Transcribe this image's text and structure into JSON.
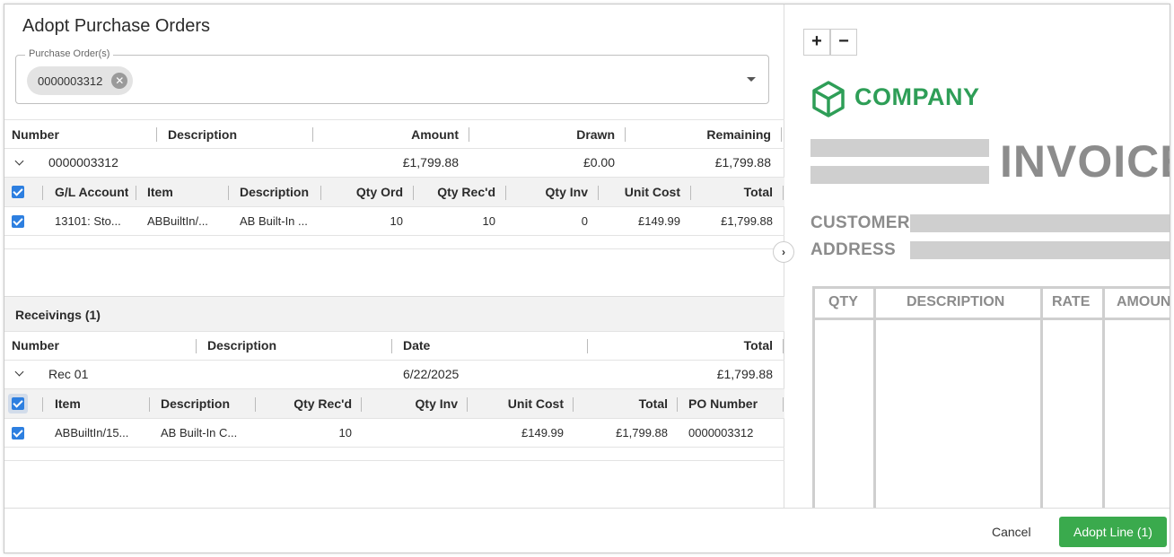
{
  "dialog": {
    "title": "Adopt Purchase Orders",
    "po_field_label": "Purchase Order(s)",
    "po_chip": "0000003312"
  },
  "po_table": {
    "headers": [
      "Number",
      "Description",
      "Amount",
      "Drawn",
      "Remaining"
    ],
    "row": {
      "number": "0000003312",
      "description": "",
      "amount": "£1,799.88",
      "drawn": "£0.00",
      "remaining": "£1,799.88"
    },
    "line_headers": [
      "G/L Account",
      "Item",
      "Description",
      "Qty Ord",
      "Qty Rec'd",
      "Qty Inv",
      "Unit Cost",
      "Total"
    ],
    "line": {
      "gl_account": "13101: Sto...",
      "item": "ABBuiltIn/...",
      "description": "AB Built-In ...",
      "qty_ord": "10",
      "qty_recd": "10",
      "qty_inv": "0",
      "unit_cost": "£149.99",
      "total": "£1,799.88"
    }
  },
  "receivings": {
    "title": "Receivings (1)",
    "headers": [
      "Number",
      "Description",
      "Date",
      "Total"
    ],
    "row": {
      "number": "Rec 01",
      "description": "",
      "date": "6/22/2025",
      "total": "£1,799.88"
    },
    "line_headers": [
      "Item",
      "Description",
      "Qty Rec'd",
      "Qty Inv",
      "Unit Cost",
      "Total",
      "PO Number"
    ],
    "line": {
      "item": "ABBuiltIn/15...",
      "description": "AB Built-In C...",
      "qty_recd": "10",
      "qty_inv": "",
      "unit_cost": "£149.99",
      "total": "£1,799.88",
      "po_number": "0000003312"
    }
  },
  "preview": {
    "zoom_in": "+",
    "zoom_out": "−",
    "company": "COMPANY",
    "invoice": "INVOICE",
    "customer": "CUSTOMER",
    "address": "ADDRESS",
    "table_headers": [
      "QTY",
      "DESCRIPTION",
      "RATE",
      "AMOUNT"
    ]
  },
  "footer": {
    "cancel": "Cancel",
    "adopt": "Adopt Line (1)"
  },
  "colors": {
    "accent": "#2d7fe0",
    "adopt_button": "#3aaa4d",
    "company_green": "#2e9e57",
    "invoice_gray": "#8c8c8c"
  },
  "icons": {
    "chip_remove": "close-circle-icon",
    "dropdown": "caret-down-icon",
    "expand_row": "chevron-down-icon",
    "panel_toggle": "chevron-right-icon",
    "company_logo": "cube-icon"
  }
}
